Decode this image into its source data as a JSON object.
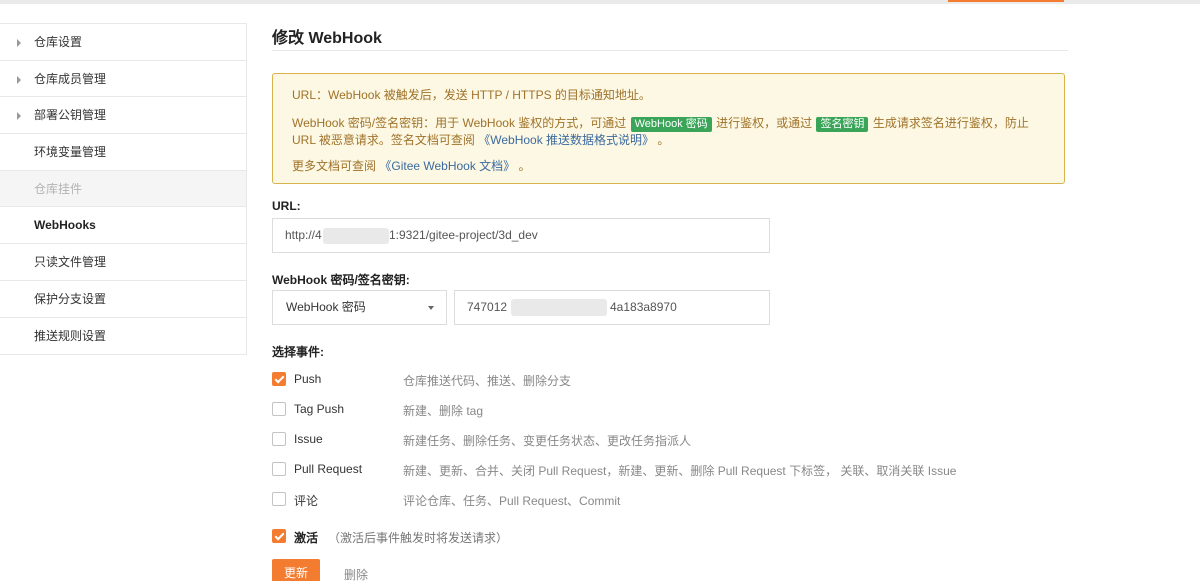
{
  "sidebar": {
    "items": [
      {
        "label": "仓库设置"
      },
      {
        "label": "仓库成员管理"
      },
      {
        "label": "部署公钥管理"
      },
      {
        "label": "环境变量管理"
      },
      {
        "label": "仓库挂件"
      },
      {
        "label": "WebHooks"
      },
      {
        "label": "只读文件管理"
      },
      {
        "label": "保护分支设置"
      },
      {
        "label": "推送规则设置"
      }
    ]
  },
  "page": {
    "title": "修改 WebHook"
  },
  "notice": {
    "line1": "URL：WebHook 被触发后，发送 HTTP / HTTPS 的目标通知地址。",
    "line2_a": "WebHook 密码/签名密钥：用于 WebHook 鉴权的方式，可通过",
    "badge_password": "WebHook 密码",
    "line2_b": "进行鉴权，或通过",
    "badge_sign": "签名密钥",
    "line2_c": "生成请求签名进行鉴权，防止 URL 被恶意请求。签名文档可查阅",
    "link_push_doc": "《WebHook 推送数据格式说明》",
    "line2_end": "。",
    "line3_a": "更多文档可查阅",
    "link_gitee_doc": "《Gitee WebHook 文档》",
    "line3_end": "。"
  },
  "form": {
    "url_label": "URL:",
    "url_value_prefix": "http://4",
    "url_value_suffix": "1:9321/gitee-project/3d_dev",
    "secret_label": "WebHook 密码/签名密钥:",
    "secret_type": "WebHook 密码",
    "secret_value_prefix": "747012",
    "secret_value_suffix": "4a183a8970",
    "events_label": "选择事件:"
  },
  "events": [
    {
      "name": "Push",
      "desc": "仓库推送代码、推送、删除分支",
      "checked": true
    },
    {
      "name": "Tag Push",
      "desc": "新建、删除 tag",
      "checked": false
    },
    {
      "name": "Issue",
      "desc": "新建任务、删除任务、变更任务状态、更改任务指派人",
      "checked": false
    },
    {
      "name": "Pull Request",
      "desc": "新建、更新、合并、关闭 Pull Request，新建、更新、删除 Pull Request 下标签， 关联、取消关联 Issue",
      "checked": false
    },
    {
      "name": "评论",
      "desc": "评论仓库、任务、Pull Request、Commit",
      "checked": false
    }
  ],
  "activate": {
    "label": "激活",
    "hint": "（激活后事件触发时将发送请求）",
    "checked": true
  },
  "actions": {
    "update_label": "更新",
    "delete_label": "删除"
  },
  "colors": {
    "accent": "#f47c30",
    "notice_bg": "#fcf8e3",
    "notice_border": "#d8b34d",
    "badge_green": "#3aa559"
  }
}
